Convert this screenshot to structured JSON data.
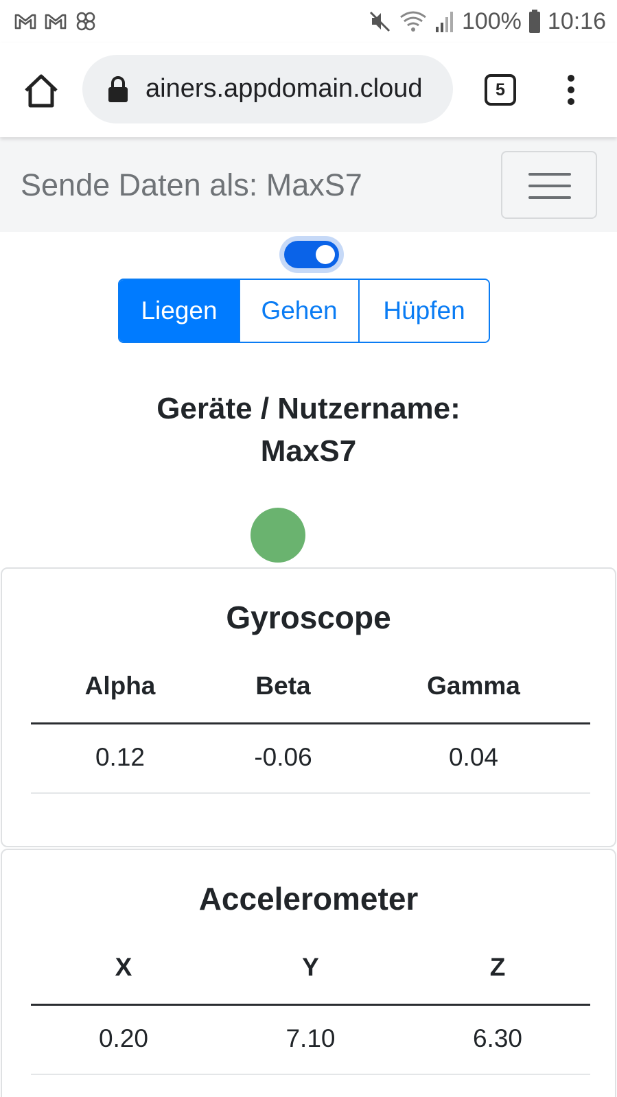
{
  "status_bar": {
    "notification_icons": [
      "gmail-icon",
      "gmail-icon",
      "pinwheel-icon"
    ],
    "battery": "100%",
    "time": "10:16"
  },
  "browser": {
    "url": "ainers.appdomain.cloud",
    "tab_count": "5"
  },
  "navbar": {
    "brand": "Sende Daten als: MaxS7"
  },
  "toggle": {
    "on": true
  },
  "activity_buttons": [
    {
      "label": "Liegen",
      "active": true
    },
    {
      "label": "Gehen",
      "active": false
    },
    {
      "label": "Hüpfen",
      "active": false
    }
  ],
  "device": {
    "label": "Geräte / Nutzername:",
    "name": "MaxS7",
    "status_color": "#6ab36f"
  },
  "gyroscope": {
    "title": "Gyroscope",
    "headers": [
      "Alpha",
      "Beta",
      "Gamma"
    ],
    "values": [
      "0.12",
      "-0.06",
      "0.04"
    ]
  },
  "accelerometer": {
    "title": "Accelerometer",
    "headers": [
      "X",
      "Y",
      "Z"
    ],
    "values": [
      "0.20",
      "7.10",
      "6.30"
    ]
  },
  "colors": {
    "primary": "#007bff",
    "success_dot": "#6ab36f"
  }
}
